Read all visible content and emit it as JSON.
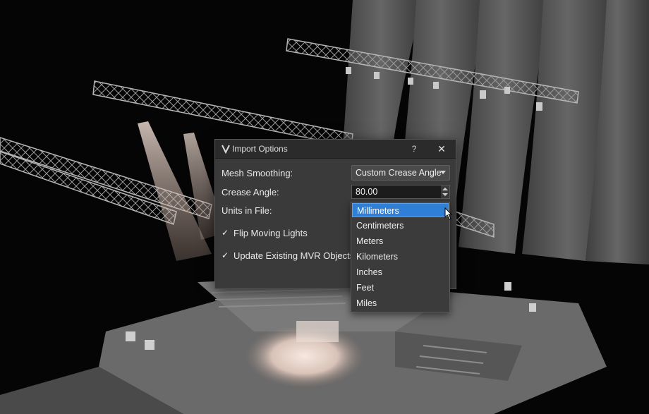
{
  "dialog": {
    "title": "Import Options",
    "help_label": "?",
    "close_label": "✕",
    "mesh_smoothing": {
      "label": "Mesh Smoothing:",
      "value": "Custom Crease Angle"
    },
    "crease_angle": {
      "label": "Crease Angle:",
      "value": "80.00"
    },
    "units": {
      "label": "Units in File:",
      "options": [
        "Millimeters",
        "Centimeters",
        "Meters",
        "Kilometers",
        "Inches",
        "Feet",
        "Miles"
      ],
      "selected": "Millimeters"
    },
    "flip_moving_lights": {
      "label": "Flip Moving Lights",
      "checked": true,
      "check_glyph": "✓"
    },
    "update_mvr": {
      "label": "Update Existing MVR Objects",
      "checked": true,
      "check_glyph": "✓"
    }
  },
  "colors": {
    "dialog_bg": "#3a3a3a",
    "titlebar_bg": "#2b2b2b",
    "selection": "#2f7fd6"
  }
}
